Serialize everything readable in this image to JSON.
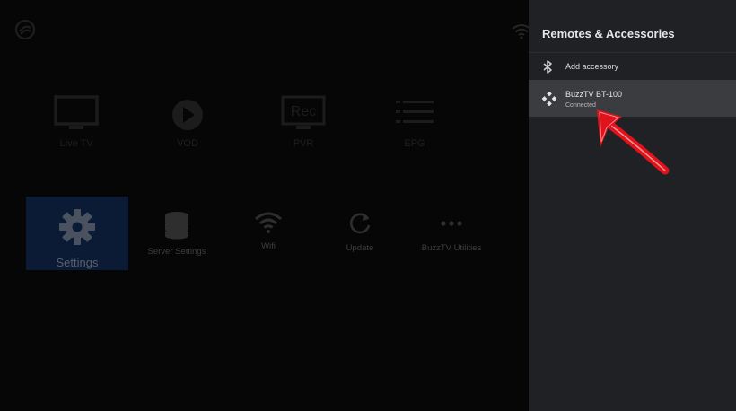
{
  "launcher": {
    "top_row": [
      {
        "label": "Live TV",
        "icon": "tv-icon"
      },
      {
        "label": "VOD",
        "icon": "play-circle-icon"
      },
      {
        "label": "PVR",
        "icon": "rec-icon",
        "icon_text": "Rec"
      },
      {
        "label": "EPG",
        "icon": "list-icon"
      }
    ],
    "bottom_row": [
      {
        "label": "Settings",
        "icon": "gear-icon",
        "selected": true
      },
      {
        "label": "Server Settings",
        "icon": "database-icon"
      },
      {
        "label": "Wifi",
        "icon": "wifi-icon"
      },
      {
        "label": "Update",
        "icon": "refresh-icon"
      },
      {
        "label": "BuzzTV Utilities",
        "icon": "more-dots-icon"
      }
    ]
  },
  "panel": {
    "title": "Remotes & Accessories",
    "add_accessory": {
      "label": "Add accessory",
      "icon": "bluetooth-icon"
    },
    "device": {
      "name": "BuzzTV BT-100",
      "status": "Connected",
      "icon": "gamepad-icon"
    }
  },
  "colors": {
    "panel_bg": "#202124",
    "selected_row_bg": "#3b3c3f",
    "selected_tile_bg": "#0b1b36",
    "annotation_red": "#e0121b"
  }
}
